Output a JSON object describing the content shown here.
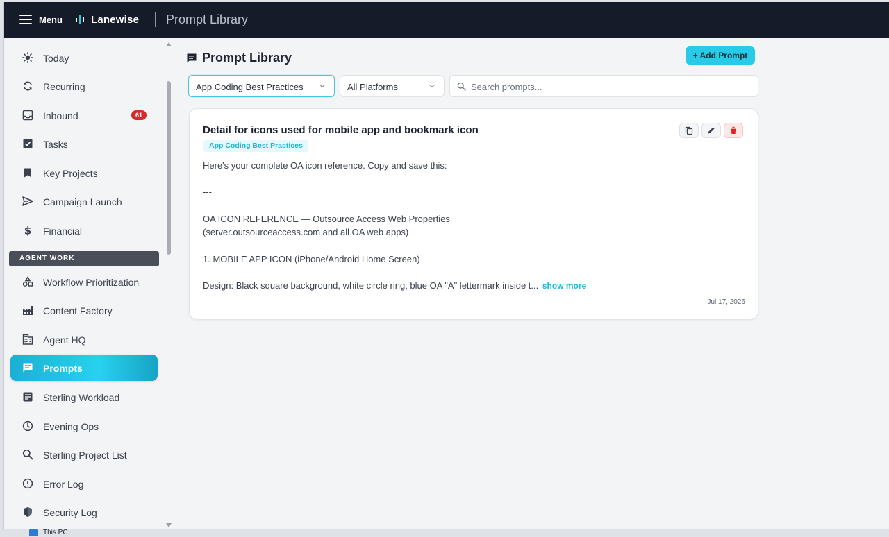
{
  "topbar": {
    "menu_label": "Menu",
    "brand": "Lanewise",
    "title": "Prompt Library"
  },
  "sidebar": {
    "items": [
      {
        "label": "Today",
        "icon": "sun-icon"
      },
      {
        "label": "Recurring",
        "icon": "refresh-icon"
      },
      {
        "label": "Inbound",
        "icon": "inbox-icon",
        "badge": "61"
      },
      {
        "label": "Tasks",
        "icon": "checkbox-icon"
      },
      {
        "label": "Key Projects",
        "icon": "bookmark-icon"
      },
      {
        "label": "Campaign Launch",
        "icon": "send-icon"
      },
      {
        "label": "Financial",
        "icon": "dollar-icon"
      }
    ],
    "section_label": "AGENT WORK",
    "agent_items": [
      {
        "label": "Workflow Prioritization",
        "icon": "shapes-icon"
      },
      {
        "label": "Content Factory",
        "icon": "factory-icon"
      },
      {
        "label": "Agent HQ",
        "icon": "building-icon"
      },
      {
        "label": "Prompts",
        "icon": "chat-icon",
        "active": true
      },
      {
        "label": "Sterling Workload",
        "icon": "document-icon"
      },
      {
        "label": "Evening Ops",
        "icon": "clock-icon"
      },
      {
        "label": "Sterling Project List",
        "icon": "search-icon"
      },
      {
        "label": "Error Log",
        "icon": "alert-icon"
      },
      {
        "label": "Security Log",
        "icon": "shield-icon"
      }
    ]
  },
  "main": {
    "page_title": "Prompt Library",
    "add_button": "+ Add Prompt",
    "category_filter": "App Coding Best Practices",
    "platform_filter": "All Platforms",
    "search_placeholder": "Search prompts...",
    "card": {
      "title": "Detail for icons used for mobile app and bookmark icon",
      "tag": "App Coding Best Practices",
      "lines": [
        "Here's your complete OA icon reference. Copy and save this:",
        "---",
        "OA ICON REFERENCE — Outsource Access Web Properties",
        "(server.outsourceaccess.com and all OA web apps)",
        "1. MOBILE APP ICON (iPhone/Android Home Screen)",
        "Design: Black square background, white circle ring, blue OA \"A\" lettermark inside t..."
      ],
      "show_more": "show more",
      "date": "Jul 17, 2026"
    }
  },
  "taskbar": {
    "item": "This PC"
  },
  "colors": {
    "topbar": "#151b28",
    "accent": "#27cbe8",
    "badge": "#d62b2b",
    "danger": "#e02424"
  }
}
